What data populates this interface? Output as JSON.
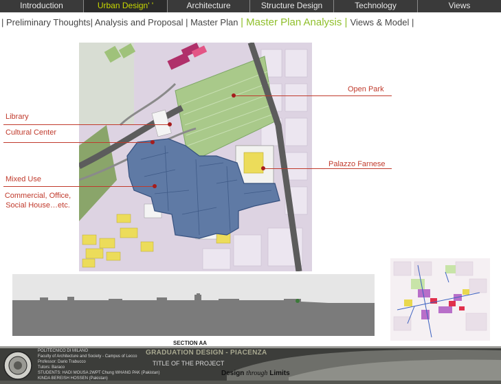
{
  "nav": {
    "tabs": [
      {
        "label": "Introduction",
        "active": false
      },
      {
        "label": "Urban Design' '",
        "active": true
      },
      {
        "label": "Architecture",
        "active": false
      },
      {
        "label": "Structure Design",
        "active": false
      },
      {
        "label": "Technology",
        "active": false
      },
      {
        "label": "Views",
        "active": false
      }
    ]
  },
  "breadcrumb": {
    "before": "| Preliminary  Thoughts| Analysis and Proposal | Master Plan ",
    "current": "| Master Plan Analysis | ",
    "after": "Views & Model |"
  },
  "map_labels": {
    "open_park": "Open Park",
    "library": "Library",
    "cultural_center": "Cultural Center",
    "palazzo_farnese": "Palazzo Farnese",
    "mixed_use": "Mixed Use",
    "mixed_use_detail": "Commercial, Office, Social House…etc."
  },
  "section": {
    "title": "SECTION AA"
  },
  "footer": {
    "school": "POLITECNICO DI MILANO",
    "faculty": "Faculty of Architecture and Society - Campus of Lecco",
    "prof1": "Professor: Dario Trabucco",
    "prof2": "Tutors: Baraco",
    "students": "STUDENTS:  HADI MOUSA  2WPT  Chung    WHANG  PAK  (Pakistan)",
    "students2": "KINDA BEREISH  HOSSEN  (Pakistan)",
    "banner": "GRADUATION DESIGN - PIACENZA",
    "project": "TITLE OF THE PROJECT",
    "motto_a": "Design",
    "motto_b": "through",
    "motto_c": "Limits"
  },
  "colors": {
    "accent_green": "#8fbf2a",
    "nav_active": "#c9d900",
    "label_red": "#c0392b",
    "building_blue": "#5f7aa5",
    "park_green": "#9fc27a"
  }
}
